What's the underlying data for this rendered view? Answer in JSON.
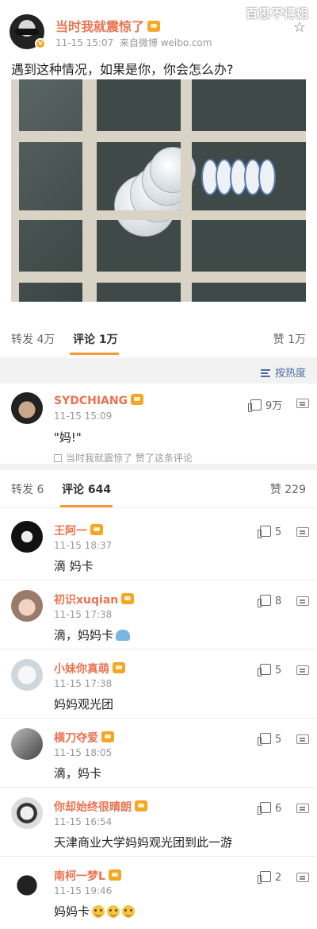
{
  "watermark": "百思不得姐",
  "post": {
    "author": "当时我就震惊了",
    "time": "11-15 15:07",
    "source": "来自微博 weibo.com",
    "text": "遇到这种情况，如果是你，你会怎么办?"
  },
  "stats": {
    "repost": "转发 4万",
    "comment": "评论 1万",
    "like": "赞 1万"
  },
  "sort": {
    "label": "按热度"
  },
  "top_comment": {
    "name": "SYDCHIANG",
    "time": "11-15 15:09",
    "text": "\"妈!\"",
    "likes": "9万",
    "liked_by": "当时我就震惊了 赞了这条评论"
  },
  "stats2": {
    "repost": "转发 6",
    "comment": "评论 644",
    "like": "赞 229"
  },
  "comments": [
    {
      "name": "王阿一",
      "time": "11-15 18:37",
      "text": "滴 妈卡",
      "likes": "5"
    },
    {
      "name": "初识xuqian",
      "time": "11-15 17:38",
      "text": "滴，妈妈卡",
      "likes": "8"
    },
    {
      "name": "小妹你真萌",
      "time": "11-15 17:38",
      "text": "妈妈观光团",
      "likes": "5"
    },
    {
      "name": "横刀夺爱",
      "time": "11-15 18:05",
      "text": "滴，妈卡",
      "likes": "5"
    },
    {
      "name": "你却始终很晴朗",
      "time": "11-15 16:54",
      "text": "天津商业大学妈妈观光团到此一游",
      "likes": "6"
    },
    {
      "name": "南柯一梦L",
      "time": "11-15 19:46",
      "text": "妈妈卡",
      "likes": "2"
    }
  ]
}
